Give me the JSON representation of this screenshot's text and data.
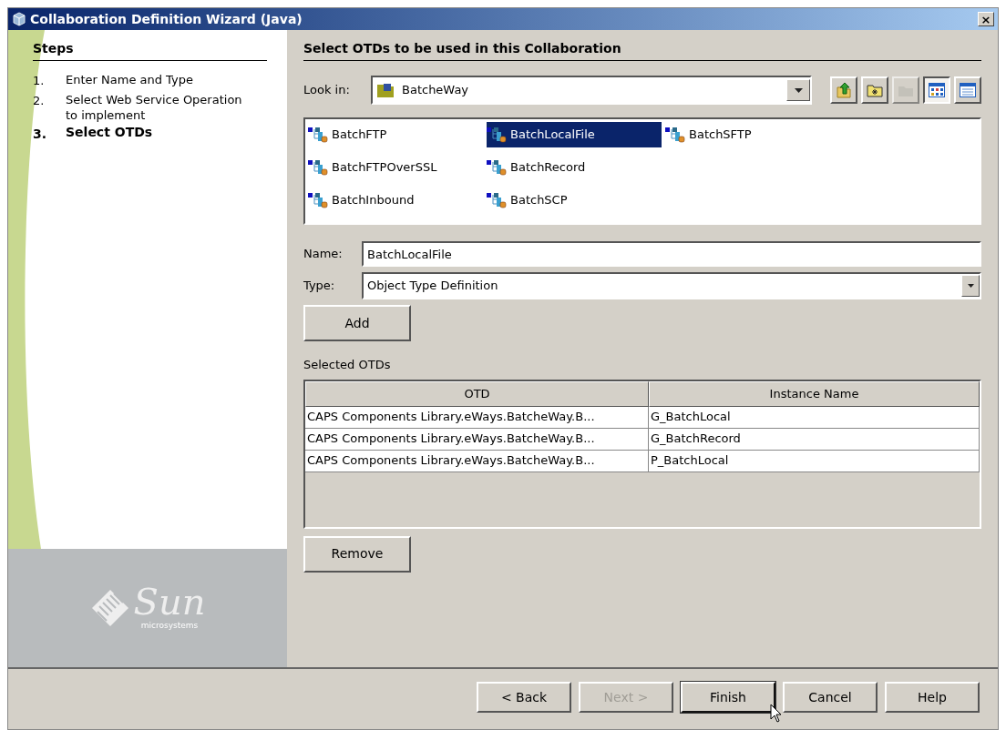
{
  "window": {
    "title": "Collaboration Definition Wizard (Java)",
    "close": "×"
  },
  "steps": {
    "heading": "Steps",
    "items": [
      {
        "number": "1.",
        "label": "Enter Name and Type",
        "selected": false
      },
      {
        "number": "2.",
        "label": "Select Web Service Operation to implement",
        "selected": false
      },
      {
        "number": "3.",
        "label": "Select OTDs",
        "selected": true
      }
    ]
  },
  "logo": {
    "name": "Sun",
    "tagline": "microsystems"
  },
  "panel": {
    "heading": "Select OTDs to be used in this Collaboration",
    "look_in": {
      "label": "Look in:",
      "value": "BatcheWay"
    },
    "toolbar": [
      {
        "kind": "up",
        "disabled": false,
        "selected": false
      },
      {
        "kind": "newfolder",
        "disabled": false,
        "selected": false
      },
      {
        "kind": "home",
        "disabled": true,
        "selected": false
      },
      {
        "kind": "list",
        "disabled": false,
        "selected": true
      },
      {
        "kind": "details",
        "disabled": false,
        "selected": false
      }
    ],
    "files": [
      {
        "label": "BatchFTP",
        "selected": false
      },
      {
        "label": "BatchFTPOverSSL",
        "selected": false
      },
      {
        "label": "BatchInbound",
        "selected": false
      },
      {
        "label": "BatchLocalFile",
        "selected": true
      },
      {
        "label": "BatchRecord",
        "selected": false
      },
      {
        "label": "BatchSCP",
        "selected": false
      },
      {
        "label": "BatchSFTP",
        "selected": false
      }
    ],
    "name": {
      "label": "Name:",
      "value": "BatchLocalFile"
    },
    "type": {
      "label": "Type:",
      "value": "Object Type Definition"
    },
    "add_button": "Add",
    "selected_label": "Selected OTDs",
    "table": {
      "columns": [
        "OTD",
        "Instance Name"
      ],
      "rows": [
        [
          "CAPS Components Library.eWays.BatcheWay.B...",
          "G_BatchLocal"
        ],
        [
          "CAPS Components Library.eWays.BatcheWay.B...",
          "G_BatchRecord"
        ],
        [
          "CAPS Components Library.eWays.BatcheWay.B...",
          "P_BatchLocal"
        ]
      ]
    },
    "remove_button": "Remove"
  },
  "buttons": [
    {
      "label": "< Back",
      "disabled": false,
      "focused": false
    },
    {
      "label": "Next >",
      "disabled": true,
      "focused": false
    },
    {
      "label": "Finish",
      "disabled": false,
      "focused": true
    },
    {
      "label": "Cancel",
      "disabled": false,
      "focused": false
    },
    {
      "label": "Help",
      "disabled": false,
      "focused": false
    }
  ]
}
